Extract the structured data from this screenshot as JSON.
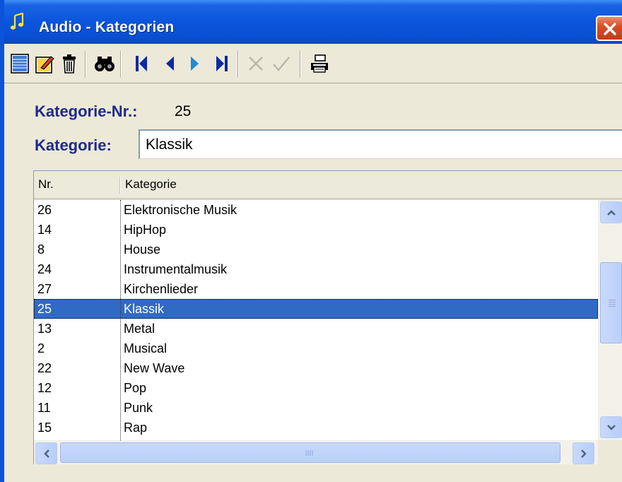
{
  "window": {
    "title": "Audio - Kategorien"
  },
  "toolbar": {
    "buttons": [
      {
        "icon": "new-record-icon"
      },
      {
        "icon": "edit-record-icon"
      },
      {
        "icon": "delete-icon"
      },
      {
        "icon": "search-icon"
      },
      {
        "icon": "first-record-icon"
      },
      {
        "icon": "previous-record-icon"
      },
      {
        "icon": "next-record-icon"
      },
      {
        "icon": "last-record-icon"
      },
      {
        "icon": "cancel-icon"
      },
      {
        "icon": "confirm-icon"
      },
      {
        "icon": "print-icon"
      }
    ]
  },
  "form": {
    "nr_label": "Kategorie-Nr.:",
    "nr_value": "25",
    "kategorie_label": "Kategorie:",
    "kategorie_value": "Klassik"
  },
  "grid": {
    "headers": [
      "Nr.",
      "Kategorie"
    ],
    "rows": [
      {
        "nr": "26",
        "kategorie": "Elektronische Musik"
      },
      {
        "nr": "14",
        "kategorie": "HipHop"
      },
      {
        "nr": "8",
        "kategorie": "House"
      },
      {
        "nr": "24",
        "kategorie": "Instrumentalmusik"
      },
      {
        "nr": "27",
        "kategorie": "Kirchenlieder"
      },
      {
        "nr": "25",
        "kategorie": "Klassik"
      },
      {
        "nr": "13",
        "kategorie": "Metal"
      },
      {
        "nr": "2",
        "kategorie": "Musical"
      },
      {
        "nr": "22",
        "kategorie": "New Wave"
      },
      {
        "nr": "12",
        "kategorie": "Pop"
      },
      {
        "nr": "11",
        "kategorie": "Punk"
      },
      {
        "nr": "15",
        "kategorie": "Rap"
      }
    ],
    "selected_nr": "25"
  },
  "colors": {
    "titlebar": "#0a55dc",
    "label": "#1f2a8c",
    "selection": "#316ac5",
    "close": "#d6502a"
  }
}
